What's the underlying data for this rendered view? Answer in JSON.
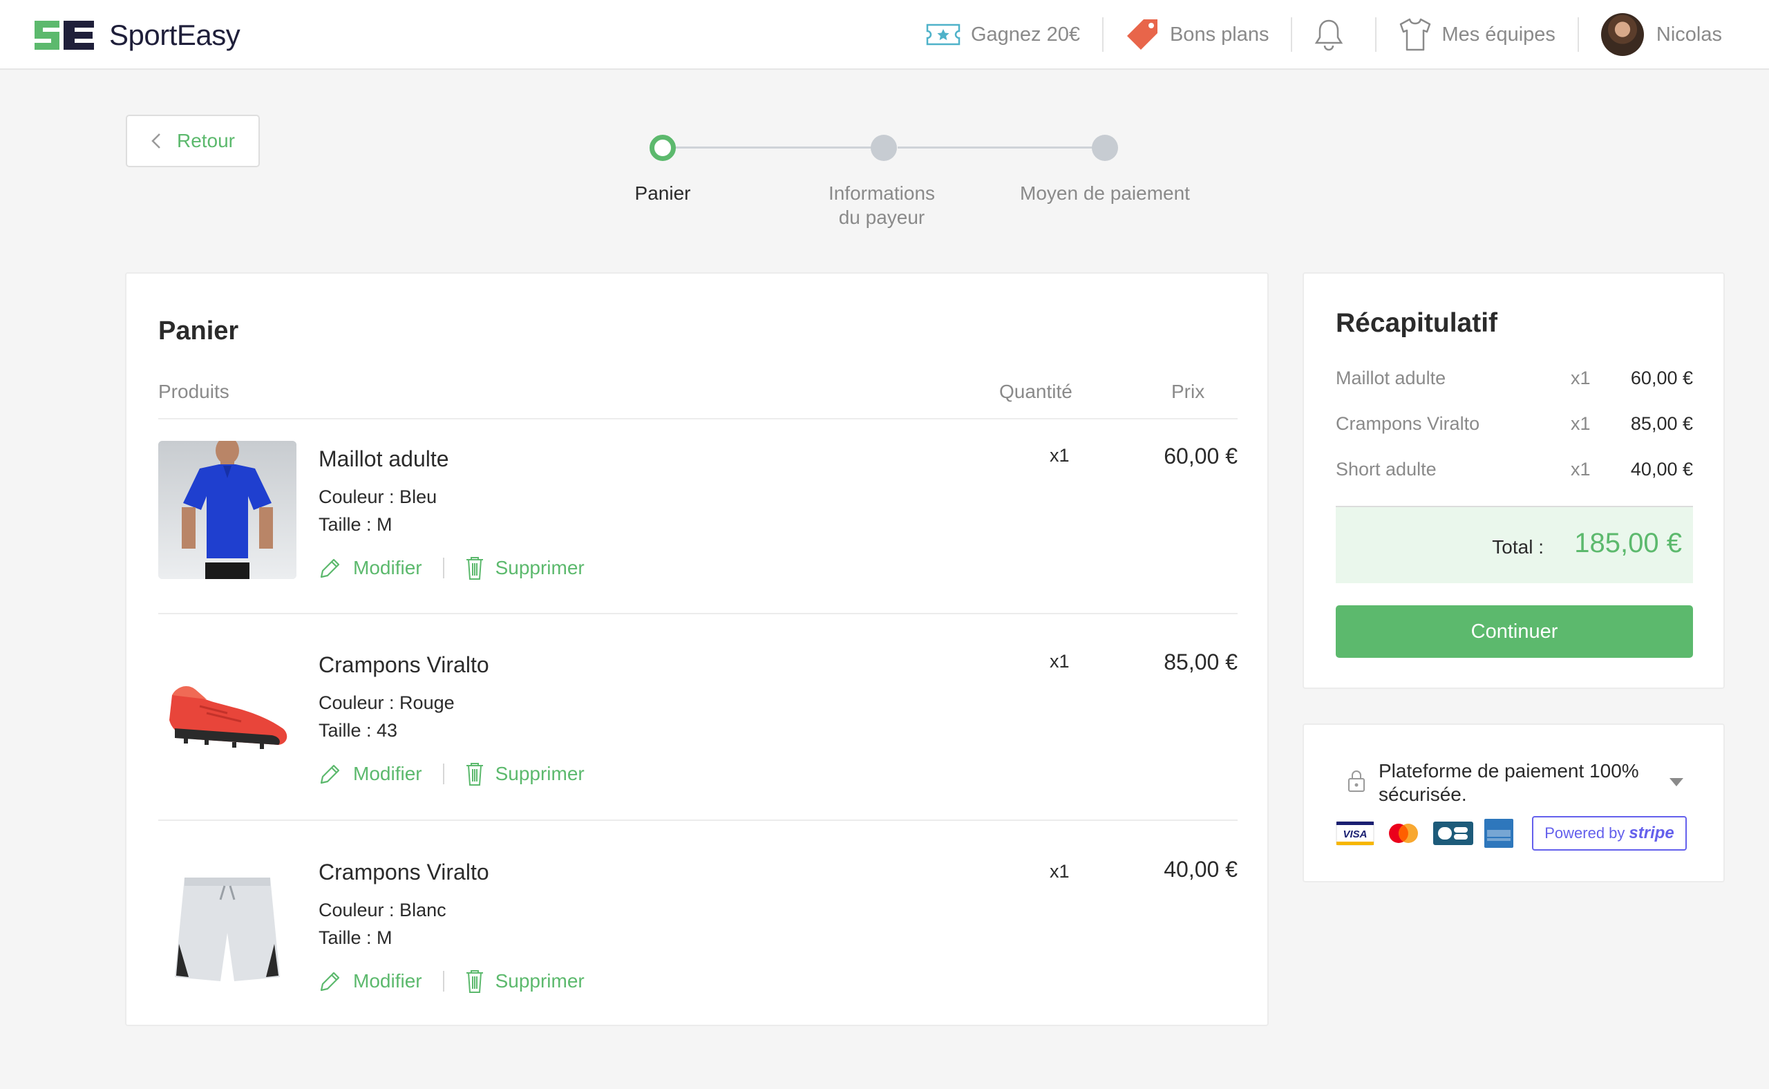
{
  "header": {
    "brand": "SportEasy",
    "nav": [
      {
        "label": "Gagnez 20€",
        "icon": "ticket-icon"
      },
      {
        "label": "Bons plans",
        "icon": "tag-icon"
      },
      {
        "label": "",
        "icon": "bell-icon"
      },
      {
        "label": "Mes équipes",
        "icon": "jersey-icon"
      },
      {
        "label": "Nicolas",
        "icon": "avatar"
      }
    ]
  },
  "back": {
    "label": "Retour"
  },
  "stepper": {
    "steps": [
      {
        "label": "Panier",
        "state": "active"
      },
      {
        "label_line1": "Informations",
        "label_line2": "du payeur",
        "state": "upcoming"
      },
      {
        "label": "Moyen de paiement",
        "state": "upcoming"
      }
    ]
  },
  "cart": {
    "title": "Panier",
    "columns": {
      "products": "Produits",
      "quantity": "Quantité",
      "price": "Prix"
    },
    "items": [
      {
        "name": "Maillot adulte",
        "color": "Couleur : Bleu",
        "size": "Taille : M",
        "qty": "x1",
        "price": "60,00 €",
        "image": "blue-jersey"
      },
      {
        "name": "Crampons Viralto",
        "color": "Couleur : Rouge",
        "size": "Taille : 43",
        "qty": "x1",
        "price": "85,00 €",
        "image": "red-boot"
      },
      {
        "name": "Crampons Viralto",
        "color": "Couleur : Blanc",
        "size": "Taille : M",
        "qty": "x1",
        "price": "40,00 €",
        "image": "white-shorts"
      }
    ],
    "actions": {
      "edit": "Modifier",
      "delete": "Supprimer"
    }
  },
  "summary": {
    "title": "Récapitulatif",
    "rows": [
      {
        "name": "Maillot adulte",
        "qty": "x1",
        "price": "60,00 €"
      },
      {
        "name": "Crampons Viralto",
        "qty": "x1",
        "price": "85,00 €"
      },
      {
        "name": "Short adulte",
        "qty": "x1",
        "price": "40,00 €"
      }
    ],
    "total_label": "Total :",
    "total_value": "185,00 €",
    "continue": "Continuer"
  },
  "payment": {
    "title": "Plateforme de paiement 100% sécurisée.",
    "card_brands": [
      "VISA",
      "Mastercard",
      "CB",
      "American Express"
    ],
    "powered_by": "Powered by",
    "stripe": "stripe"
  },
  "colors": {
    "accent": "#5cb96d",
    "brand_dark": "#1f1f3a",
    "stripe": "#6460ec",
    "tag": "#e8654a"
  }
}
